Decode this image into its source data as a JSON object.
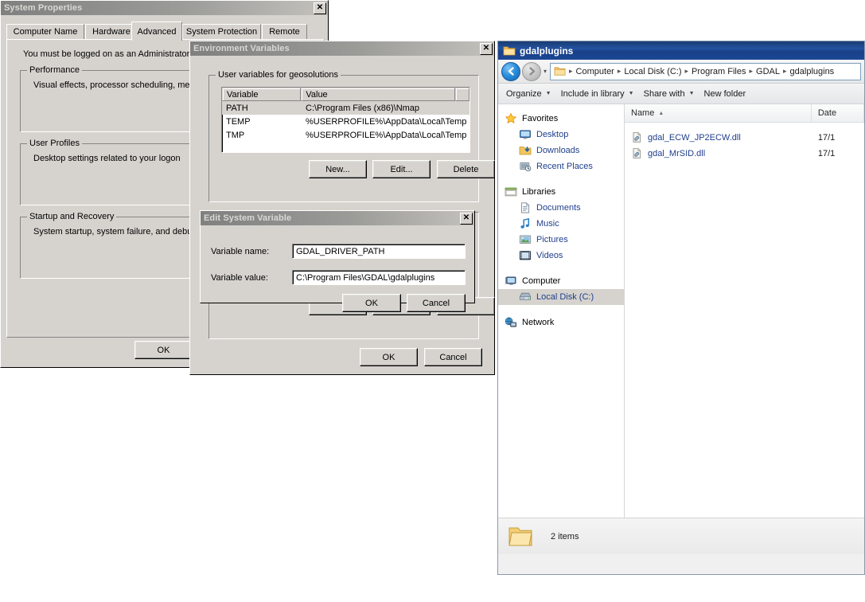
{
  "system_properties": {
    "title": "System Properties",
    "close_label": "✕",
    "tabs": [
      {
        "label": "Computer Name",
        "selected": false
      },
      {
        "label": "Hardware",
        "selected": false
      },
      {
        "label": "Advanced",
        "selected": true
      },
      {
        "label": "System Protection",
        "selected": false
      },
      {
        "label": "Remote",
        "selected": false
      }
    ],
    "admin_notice": "You must be logged on as an Administrator to",
    "groups": [
      {
        "label": "Performance",
        "text": "Visual effects, processor scheduling, memor"
      },
      {
        "label": "User Profiles",
        "text": "Desktop settings related to your logon"
      },
      {
        "label": "Startup and Recovery",
        "text": "System startup, system failure, and debuggi"
      }
    ],
    "ok_label": "OK"
  },
  "environment_variables": {
    "title": "Environment Variables",
    "close_label": "✕",
    "user_group_label": "User variables for geosolutions",
    "columns": [
      "Variable",
      "Value"
    ],
    "rows": [
      {
        "variable": "PATH",
        "value": "C:\\Program Files (x86)\\Nmap",
        "selected": true
      },
      {
        "variable": "TEMP",
        "value": "%USERPROFILE%\\AppData\\Local\\Temp",
        "selected": false
      },
      {
        "variable": "TMP",
        "value": "%USERPROFILE%\\AppData\\Local\\Temp",
        "selected": false
      }
    ],
    "buttons": {
      "new_label": "New...",
      "edit_label": "Edit...",
      "delete_label": "Delete"
    },
    "ok_label": "OK",
    "cancel_label": "Cancel"
  },
  "edit_system_variable": {
    "title": "Edit System Variable",
    "close_label": "✕",
    "name_label": "Variable name:",
    "name_value": "GDAL_DRIVER_PATH",
    "value_label": "Variable value:",
    "value_value": "C:\\Program Files\\GDAL\\gdalplugins",
    "ok_label": "OK",
    "cancel_label": "Cancel"
  },
  "explorer": {
    "title": "gdalplugins",
    "breadcrumbs": [
      "Computer",
      "Local Disk (C:)",
      "Program Files",
      "GDAL",
      "gdalplugins"
    ],
    "toolbar": [
      {
        "label": "Organize",
        "caret": true
      },
      {
        "label": "Include in library",
        "caret": true
      },
      {
        "label": "Share with",
        "caret": true
      },
      {
        "label": "New folder",
        "caret": false
      }
    ],
    "sidebar": [
      {
        "type": "group",
        "label": "Favorites",
        "icon": "star-icon"
      },
      {
        "type": "item",
        "label": "Desktop",
        "icon": "desktop-icon",
        "selected": false
      },
      {
        "type": "item",
        "label": "Downloads",
        "icon": "downloads-icon",
        "selected": false
      },
      {
        "type": "item",
        "label": "Recent Places",
        "icon": "recent-places-icon",
        "selected": false
      },
      {
        "type": "spacer"
      },
      {
        "type": "group",
        "label": "Libraries",
        "icon": "libraries-icon"
      },
      {
        "type": "item",
        "label": "Documents",
        "icon": "document-icon",
        "selected": false
      },
      {
        "type": "item",
        "label": "Music",
        "icon": "music-icon",
        "selected": false
      },
      {
        "type": "item",
        "label": "Pictures",
        "icon": "pictures-icon",
        "selected": false
      },
      {
        "type": "item",
        "label": "Videos",
        "icon": "videos-icon",
        "selected": false
      },
      {
        "type": "spacer"
      },
      {
        "type": "group",
        "label": "Computer",
        "icon": "computer-icon"
      },
      {
        "type": "item",
        "label": "Local Disk (C:)",
        "icon": "harddisk-icon",
        "selected": true
      },
      {
        "type": "spacer"
      },
      {
        "type": "group",
        "label": "Network",
        "icon": "network-icon"
      }
    ],
    "columns": [
      {
        "label": "Name",
        "sorted": true,
        "sort_glyph": "▲"
      },
      {
        "label": "Date",
        "sorted": false,
        "sort_glyph": ""
      }
    ],
    "files": [
      {
        "name": "gdal_ECW_JP2ECW.dll",
        "date": "17/1",
        "icon": "dll-file-icon"
      },
      {
        "name": "gdal_MrSID.dll",
        "date": "17/1",
        "icon": "dll-file-icon"
      }
    ],
    "status": {
      "item_count": "2 items",
      "icon": "folder-icon"
    }
  }
}
